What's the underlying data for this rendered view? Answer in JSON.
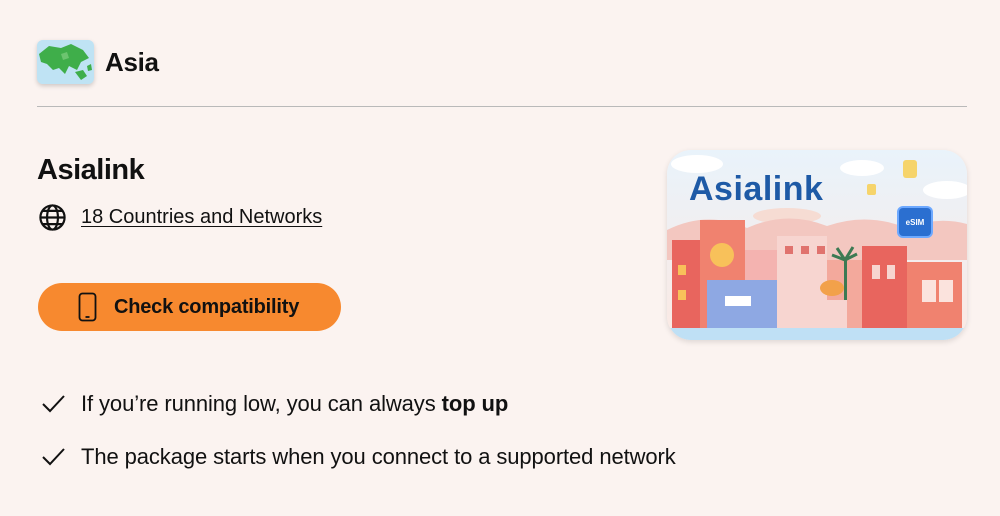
{
  "region": {
    "title": "Asia",
    "thumbnail_icon": "asia-map-icon"
  },
  "plan": {
    "name": "Asialink",
    "coverage_link": "18 Countries and Networks",
    "coverage_icon": "globe-icon"
  },
  "compatibility": {
    "button_label": "Check compatibility",
    "icon": "phone-icon",
    "color": "#f7892f"
  },
  "features": [
    {
      "text_before": "If you’re running low, you can always ",
      "bold": "top up"
    },
    {
      "text_before": "The package starts when you connect to a supported network",
      "bold": ""
    }
  ],
  "card": {
    "title": "Asialink",
    "chip_label": "eSIM",
    "title_color": "#1e5aa6"
  }
}
